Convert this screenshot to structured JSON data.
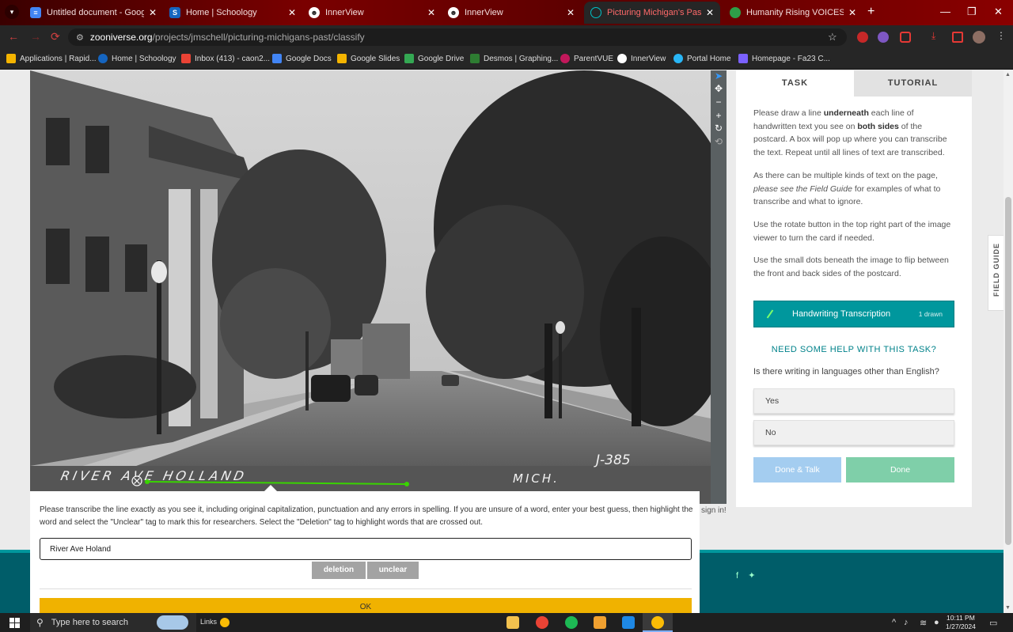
{
  "browser": {
    "tabs": [
      {
        "title": "Untitled document - Google Do",
        "color": "#4285f4",
        "glyph": "≡"
      },
      {
        "title": "Home | Schoology",
        "color": "#1565c0",
        "glyph": "S"
      },
      {
        "title": "InnerView",
        "color": "#333333",
        "glyph": "☻"
      },
      {
        "title": "InnerView",
        "color": "#333333",
        "glyph": "☻"
      },
      {
        "title": "Picturing Michigan's Past - Cl",
        "color": "#00979d",
        "glyph": "◎"
      },
      {
        "title": "Humanity Rising VOICES Survey",
        "color": "#2e9e48",
        "glyph": "◉"
      }
    ],
    "new_tab": "+",
    "url_domain": "zooniverse.org",
    "url_path": "/projects/jmschell/picturing-michigans-past/classify",
    "bookmarks": [
      {
        "label": "Applications | Rapid...",
        "color": "#f4b400"
      },
      {
        "label": "Home | Schoology",
        "color": "#1565c0"
      },
      {
        "label": "Inbox (413) - caon2...",
        "color": "#ea4335"
      },
      {
        "label": "Google Docs",
        "color": "#4285f4"
      },
      {
        "label": "Google Slides",
        "color": "#f4b400"
      },
      {
        "label": "Google Drive",
        "color": "#34a853"
      },
      {
        "label": "Desmos | Graphing...",
        "color": "#2e7d32"
      },
      {
        "label": "ParentVUE",
        "color": "#c2185b"
      },
      {
        "label": "InnerView",
        "color": "#555555"
      },
      {
        "label": "Portal Home",
        "color": "#29b6f6"
      },
      {
        "label": "Homepage - Fa23 C...",
        "color": "#7b61ff"
      }
    ]
  },
  "viewer": {
    "postcard_caption": "RIVER AVE HOLLAND",
    "postcard_caption_right": "MICH.",
    "postcard_number": "J-385",
    "sign_in": "sign in!"
  },
  "sidebar": {
    "tab_task": "TASK",
    "tab_tutorial": "TUTORIAL",
    "p1": {
      "a": "Please draw a line ",
      "b": "underneath",
      "c": " each line of handwritten text you see on ",
      "d": "both sides",
      "e": " of the postcard. A box will pop up where you can transcribe the text. Repeat until all lines of text are transcribed."
    },
    "p2": {
      "a": "As there can be multiple kinds of text on the page, ",
      "b": "please see the Field Guide",
      "c": " for examples of what to transcribe and what to ignore."
    },
    "p3": "Use the rotate button in the top right part of the image viewer to turn the card if needed.",
    "p4": "Use the small dots beneath the image to flip between the front and back sides of the postcard.",
    "task_tool_label": "Handwriting Transcription",
    "task_tool_count": "1 drawn",
    "help": "NEED SOME HELP WITH THIS TASK?",
    "question": "Is there writing in languages other than English?",
    "answers": [
      "Yes",
      "No"
    ],
    "done_talk": "Done & Talk",
    "done": "Done",
    "field_guide": "FIELD GUIDE"
  },
  "popup": {
    "instructions": "Please transcribe the line exactly as you see it, including original capitalization, punctuation and any errors in spelling. If you are unsure of a word, enter your best guess, then highlight the word and select the \"Unclear\" tag to mark this for researchers. Select the \"Deletion\" tag to highlight words that are crossed out.",
    "input_value": "River Ave Holand",
    "tag_deletion": "deletion",
    "tag_unclear": "unclear",
    "ok": "OK"
  },
  "taskbar": {
    "search_placeholder": "Type here to search",
    "links": "Links",
    "time": "10:11 PM",
    "date": "1/27/2024"
  }
}
